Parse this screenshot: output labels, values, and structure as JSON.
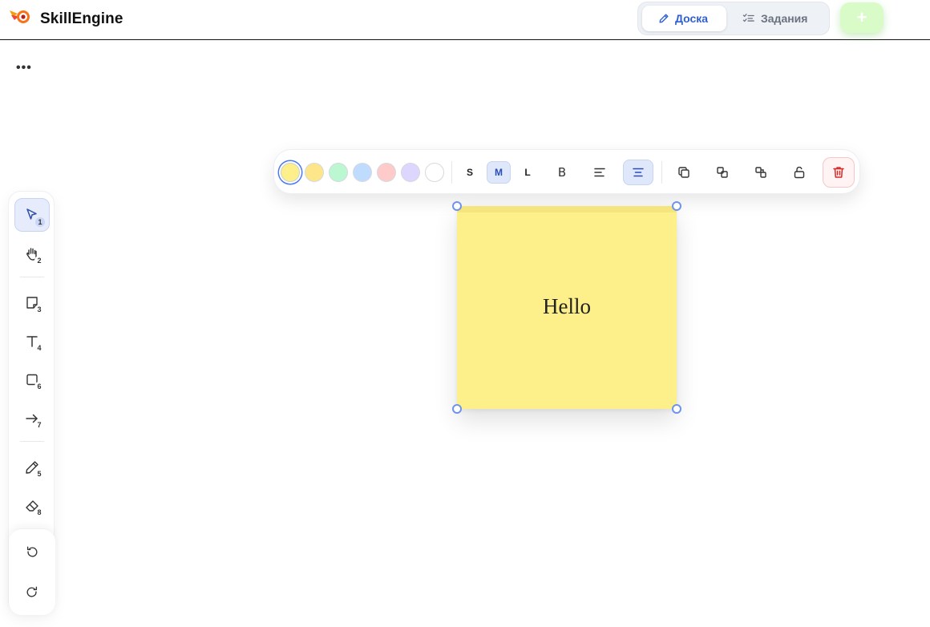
{
  "header": {
    "app_title": "SkillEngine",
    "tabs": [
      {
        "label": "Доска",
        "icon": "pencil-icon",
        "active": true
      },
      {
        "label": "Задания",
        "icon": "checklist-icon",
        "active": false
      }
    ],
    "add_label": "+"
  },
  "board": {
    "more_label": "•••"
  },
  "left_toolbar": {
    "tools": [
      {
        "name": "select",
        "icon": "cursor-icon",
        "shortcut": "1",
        "active": true
      },
      {
        "name": "hand",
        "icon": "hand-icon",
        "shortcut": "2",
        "active": false
      },
      {
        "name": "sticky-note",
        "icon": "note-icon",
        "shortcut": "3",
        "active": false
      },
      {
        "name": "text",
        "icon": "text-icon",
        "shortcut": "4",
        "active": false
      },
      {
        "name": "shape",
        "icon": "rectangle-icon",
        "shortcut": "6",
        "active": false
      },
      {
        "name": "arrow",
        "icon": "arrow-icon",
        "shortcut": "7",
        "active": false
      },
      {
        "name": "pencil",
        "icon": "pencil-icon",
        "shortcut": "5",
        "active": false
      },
      {
        "name": "eraser",
        "icon": "eraser-icon",
        "shortcut": "8",
        "active": false
      }
    ],
    "undo_icon": "undo-icon",
    "redo_icon": "redo-icon"
  },
  "format_toolbar": {
    "colors": [
      "#fdf08a",
      "#fde68a",
      "#bbf7d0",
      "#bfdbfe",
      "#fecaca",
      "#ddd6fe",
      "#ffffff"
    ],
    "selected_color": "#fdf08a",
    "sizes": [
      "S",
      "M",
      "L"
    ],
    "selected_size": "M",
    "bold_label": "B",
    "align_left_icon": "align-left-icon",
    "align_center_icon": "align-center-icon",
    "align_selected": "center",
    "duplicate_icon": "duplicate-icon",
    "bring_forward_icon": "bring-forward-icon",
    "send_backward_icon": "send-backward-icon",
    "lock_icon": "unlock-icon",
    "delete_icon": "trash-icon",
    "delete_color": "#dc2626"
  },
  "sticky": {
    "text": "Hello",
    "color": "#fdf08a"
  }
}
